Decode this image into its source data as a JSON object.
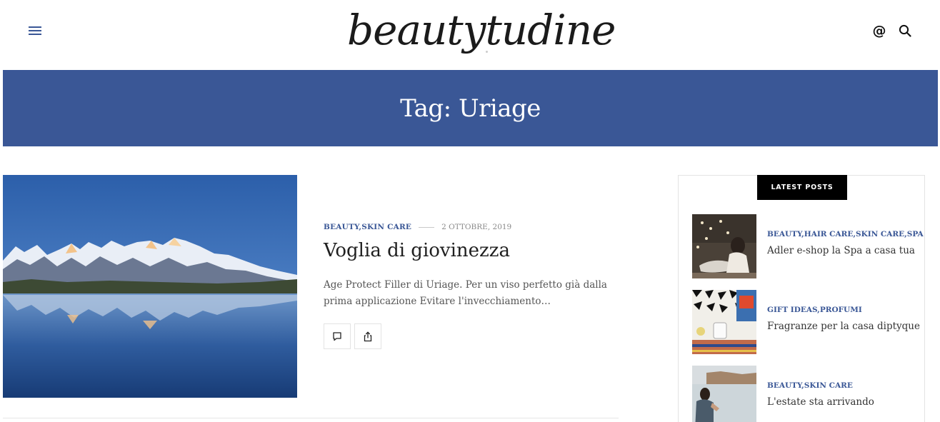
{
  "header": {
    "logo_text": "beautytudine",
    "menu_icon": "hamburger-menu-icon",
    "at_icon": "at-sign-icon",
    "at_label": "@",
    "search_icon": "search-icon"
  },
  "banner": {
    "title": "Tag: Uriage",
    "color": "#3a5796"
  },
  "article": {
    "categories": "BEAUTY,SKIN CARE",
    "date": "2 OTTOBRE, 2019",
    "title": "Voglia di giovinezza",
    "excerpt": "Age Protect Filler di Uriage. Per un viso perfetto già dalla prima applicazione Evitare l'invecchiamento…",
    "image_icon": "mountain-lake-image",
    "comment_icon": "comment-icon",
    "share_icon": "share-icon"
  },
  "sidebar": {
    "widget_title": "LATEST POSTS",
    "posts": [
      {
        "categories": "BEAUTY,HAIR CARE,SKIN CARE,SPA",
        "title": "Adler e-shop la Spa a casa tua"
      },
      {
        "categories": "GIFT IDEAS,PROFUMI",
        "title": "Fragranze per la casa diptyque"
      },
      {
        "categories": "BEAUTY,SKIN CARE",
        "title": "L'estate sta arrivando"
      }
    ]
  },
  "colors": {
    "accent": "#3a5796",
    "text": "#222222"
  }
}
